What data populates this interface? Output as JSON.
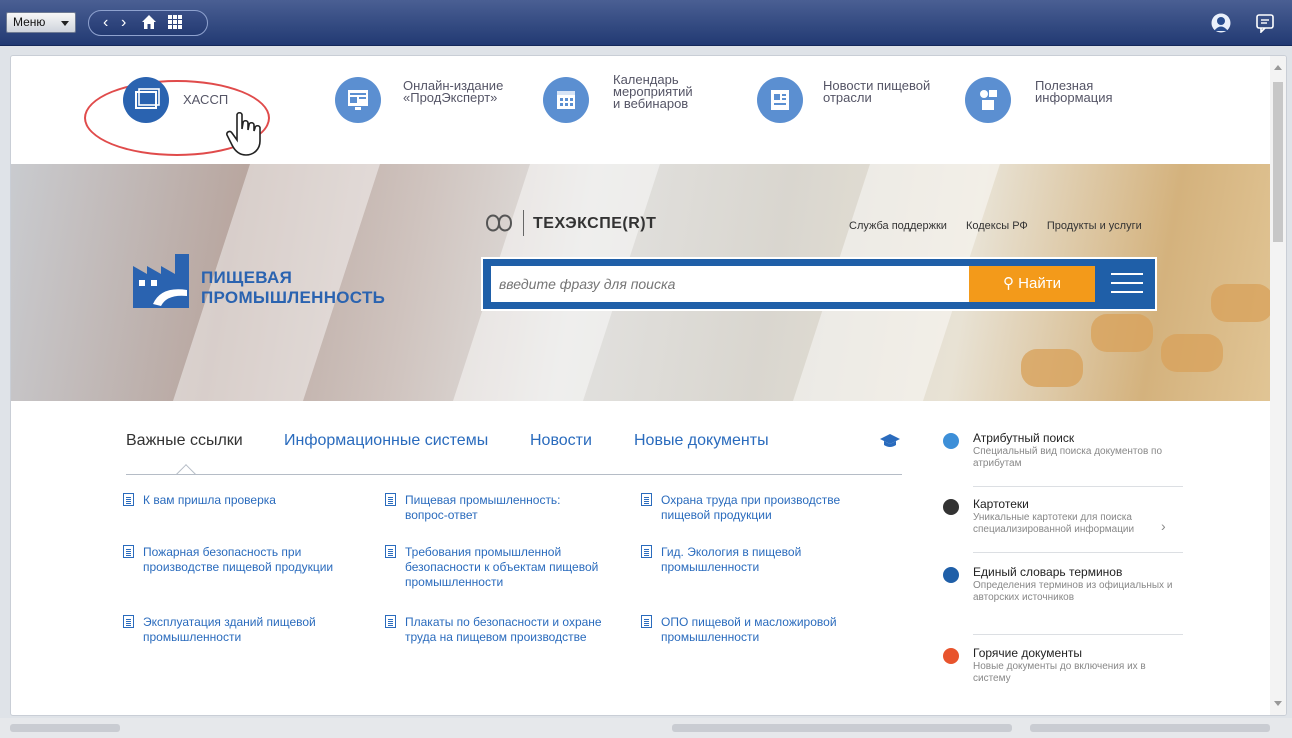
{
  "topbar": {
    "menu_label": "Меню"
  },
  "quick_links": [
    {
      "label": "ХАССП",
      "color": "#2a63b0"
    },
    {
      "label": "Онлайн-издание\n«ПродЭксперт»",
      "color": "#5b8fd1"
    },
    {
      "label": "Календарь\nмероприятий\nи вебинаров",
      "color": "#5b8fd1"
    },
    {
      "label": "Новости пищевой\nотрасли",
      "color": "#5b8fd1"
    },
    {
      "label": "Полезная\nинформация",
      "color": "#5b8fd1"
    }
  ],
  "hero": {
    "logo_text": "ТЕХЭКСПЕ(R)Т",
    "links": [
      "Служба поддержки",
      "Кодексы РФ",
      "Продукты и услуги"
    ],
    "brand_line1": "ПИЩЕВАЯ",
    "brand_line2": "ПРОМЫШЛЕННОСТЬ",
    "search_placeholder": "введите фразу для поиска",
    "search_button": "Найти",
    "accent": "#1f5fa8",
    "button_color": "#f39a1a"
  },
  "tabs": [
    "Важные ссылки",
    "Информационные системы",
    "Новости",
    "Новые документы"
  ],
  "links": [
    [
      "К вам пришла проверка",
      "Пищевая промышленность: вопрос-ответ",
      "Охрана труда при производстве пищевой продукции"
    ],
    [
      "Пожарная безопасность при производстве пищевой продукции",
      "Требования промышленной безопасности к объектам пищевой промышленности",
      "Гид. Экология в пищевой промышленности"
    ],
    [
      "Эксплуатация зданий пищевой промышленности",
      "Плакаты по безопасности и охране труда на пищевом производстве",
      "ОПО пищевой и масложировой промышленности"
    ]
  ],
  "right_panel": [
    {
      "title": "Атрибутный поиск",
      "desc": "Специальный вид поиска документов по атрибутам",
      "color": "#3d8fd8",
      "icon": "search-icon"
    },
    {
      "title": "Картотеки",
      "desc": "Уникальные картотеки для поиска специализированной информации",
      "color": "#333",
      "icon": "cards-icon"
    },
    {
      "title": "Единый словарь терминов",
      "desc": "Определения терминов из официальных и авторских источников",
      "color": "#1f5fa8",
      "icon": "dictionary-icon"
    },
    {
      "title": "Горячие документы",
      "desc": "Новые документы до включения их в систему",
      "color": "#e8542d",
      "icon": "hot-icon"
    }
  ]
}
